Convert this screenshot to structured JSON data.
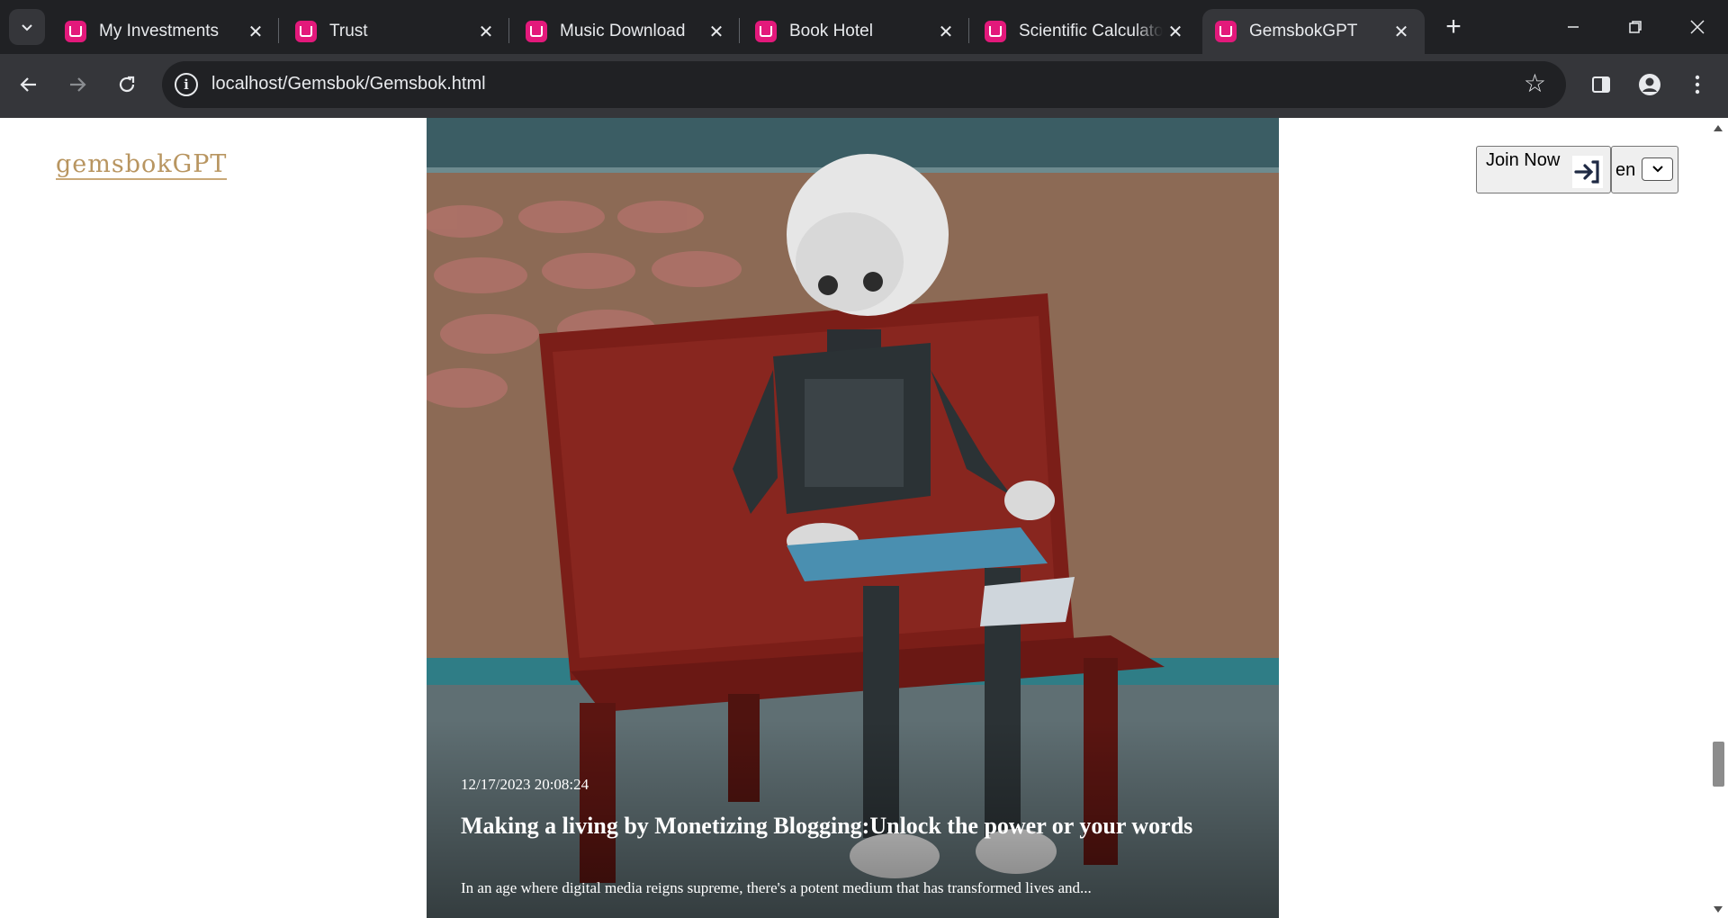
{
  "browser": {
    "tabs": [
      {
        "title": "My Investments",
        "active": false
      },
      {
        "title": "Trust",
        "active": false
      },
      {
        "title": "Music Download",
        "active": false
      },
      {
        "title": "Book Hotel",
        "active": false
      },
      {
        "title": "Scientific Calculator",
        "active": false
      },
      {
        "title": "GemsbokGPT",
        "active": true
      }
    ],
    "url": "localhost/Gemsbok/Gemsbok.html",
    "favicon_color": "#e3197b"
  },
  "header": {
    "logo_text": "gemsbokGPT",
    "join_label": "Join Now",
    "language_code": "en"
  },
  "post": {
    "date": "12/17/2023 20:08:24",
    "title": "Making a living by Monetizing Blogging:Unlock the power or your words",
    "excerpt": "In an age where digital media reigns supreme, there's a potent medium that has transformed lives and..."
  },
  "icons": {
    "tab_search": "chevron-down-icon",
    "back": "arrow-left-icon",
    "forward": "arrow-right-icon",
    "reload": "reload-icon",
    "site_info": "info-icon",
    "bookmark": "star-icon",
    "side_panel": "side-panel-icon",
    "profile": "profile-icon",
    "menu": "kebab-menu-icon",
    "join": "sign-in-icon"
  }
}
